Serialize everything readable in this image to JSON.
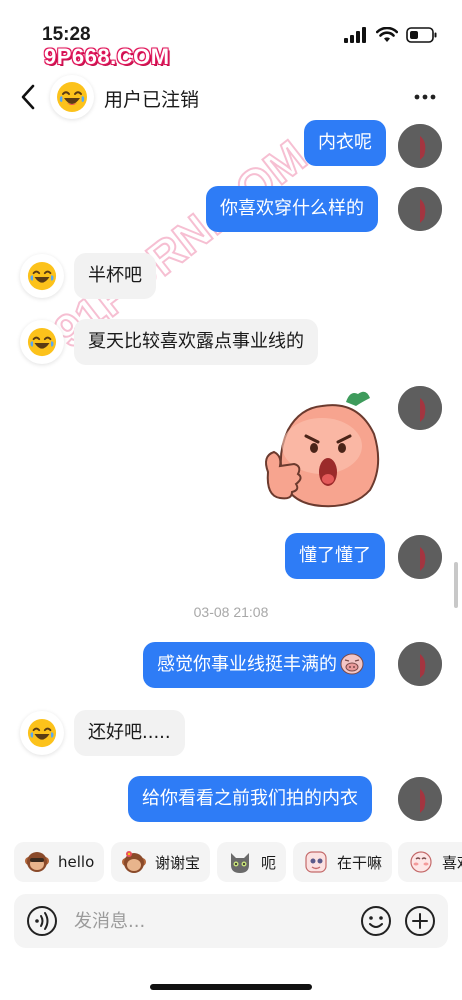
{
  "status_bar": {
    "time": "15:28"
  },
  "watermark": {
    "logo_text": "9P668.COM",
    "diagonal_text": "91PORN.COM"
  },
  "header": {
    "title": "用户已注销",
    "back_icon": "chevron-left-icon",
    "more_icon": "more-dots-icon"
  },
  "messages": [
    {
      "from": "self",
      "text": "内衣呢"
    },
    {
      "from": "self",
      "text": "你喜欢穿什么样的"
    },
    {
      "from": "peer",
      "text": "半杯吧"
    },
    {
      "from": "peer",
      "text": "夏天比较喜欢露点事业线的"
    },
    {
      "from": "self",
      "type": "sticker",
      "sticker": "peach-thumbs-up-sticker"
    },
    {
      "from": "self",
      "text": "懂了懂了"
    },
    {
      "from": "self",
      "text": "感觉你事业线挺丰满的",
      "emoji": "grinning-pig-emoji"
    },
    {
      "from": "peer",
      "text": "还好吧....."
    },
    {
      "from": "self",
      "text": "给你看看之前我们拍的内衣"
    }
  ],
  "timestamp": "03-08 21:08",
  "quick_replies": [
    {
      "label": "hello",
      "icon": "monkey-icon"
    },
    {
      "label": "谢谢宝",
      "icon": "monkey-flower-icon"
    },
    {
      "label": "呃",
      "icon": "cat-icon"
    },
    {
      "label": "在干嘛",
      "icon": "peeking-face-icon"
    },
    {
      "label": "喜欢",
      "icon": "blush-face-icon"
    }
  ],
  "input": {
    "placeholder": "发消息..."
  },
  "colors": {
    "outgoing_bubble": "#2e7cf6",
    "incoming_bubble": "#f2f2f2",
    "watermark": "#e0185c"
  }
}
